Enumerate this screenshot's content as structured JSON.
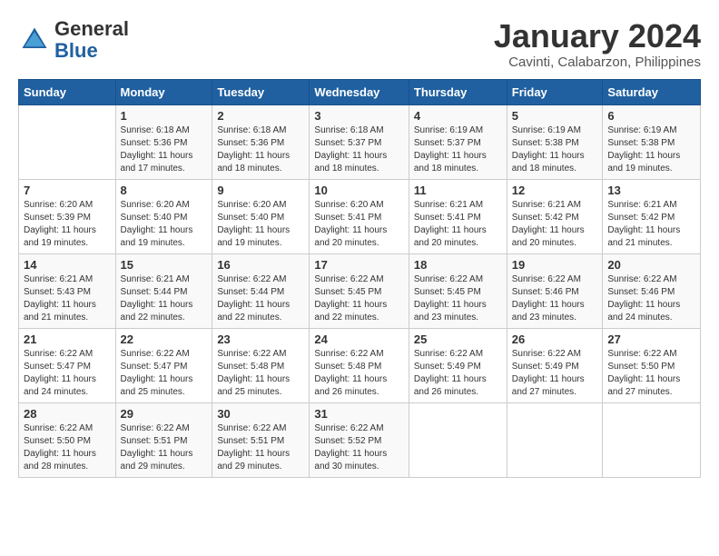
{
  "header": {
    "logo_general": "General",
    "logo_blue": "Blue",
    "month_title": "January 2024",
    "location": "Cavinti, Calabarzon, Philippines"
  },
  "days_of_week": [
    "Sunday",
    "Monday",
    "Tuesday",
    "Wednesday",
    "Thursday",
    "Friday",
    "Saturday"
  ],
  "weeks": [
    [
      {
        "day": "",
        "sunrise": "",
        "sunset": "",
        "daylight": ""
      },
      {
        "day": "1",
        "sunrise": "6:18 AM",
        "sunset": "5:36 PM",
        "daylight": "11 hours and 17 minutes."
      },
      {
        "day": "2",
        "sunrise": "6:18 AM",
        "sunset": "5:36 PM",
        "daylight": "11 hours and 18 minutes."
      },
      {
        "day": "3",
        "sunrise": "6:18 AM",
        "sunset": "5:37 PM",
        "daylight": "11 hours and 18 minutes."
      },
      {
        "day": "4",
        "sunrise": "6:19 AM",
        "sunset": "5:37 PM",
        "daylight": "11 hours and 18 minutes."
      },
      {
        "day": "5",
        "sunrise": "6:19 AM",
        "sunset": "5:38 PM",
        "daylight": "11 hours and 18 minutes."
      },
      {
        "day": "6",
        "sunrise": "6:19 AM",
        "sunset": "5:38 PM",
        "daylight": "11 hours and 19 minutes."
      }
    ],
    [
      {
        "day": "7",
        "sunrise": "6:20 AM",
        "sunset": "5:39 PM",
        "daylight": "11 hours and 19 minutes."
      },
      {
        "day": "8",
        "sunrise": "6:20 AM",
        "sunset": "5:40 PM",
        "daylight": "11 hours and 19 minutes."
      },
      {
        "day": "9",
        "sunrise": "6:20 AM",
        "sunset": "5:40 PM",
        "daylight": "11 hours and 19 minutes."
      },
      {
        "day": "10",
        "sunrise": "6:20 AM",
        "sunset": "5:41 PM",
        "daylight": "11 hours and 20 minutes."
      },
      {
        "day": "11",
        "sunrise": "6:21 AM",
        "sunset": "5:41 PM",
        "daylight": "11 hours and 20 minutes."
      },
      {
        "day": "12",
        "sunrise": "6:21 AM",
        "sunset": "5:42 PM",
        "daylight": "11 hours and 20 minutes."
      },
      {
        "day": "13",
        "sunrise": "6:21 AM",
        "sunset": "5:42 PM",
        "daylight": "11 hours and 21 minutes."
      }
    ],
    [
      {
        "day": "14",
        "sunrise": "6:21 AM",
        "sunset": "5:43 PM",
        "daylight": "11 hours and 21 minutes."
      },
      {
        "day": "15",
        "sunrise": "6:21 AM",
        "sunset": "5:44 PM",
        "daylight": "11 hours and 22 minutes."
      },
      {
        "day": "16",
        "sunrise": "6:22 AM",
        "sunset": "5:44 PM",
        "daylight": "11 hours and 22 minutes."
      },
      {
        "day": "17",
        "sunrise": "6:22 AM",
        "sunset": "5:45 PM",
        "daylight": "11 hours and 22 minutes."
      },
      {
        "day": "18",
        "sunrise": "6:22 AM",
        "sunset": "5:45 PM",
        "daylight": "11 hours and 23 minutes."
      },
      {
        "day": "19",
        "sunrise": "6:22 AM",
        "sunset": "5:46 PM",
        "daylight": "11 hours and 23 minutes."
      },
      {
        "day": "20",
        "sunrise": "6:22 AM",
        "sunset": "5:46 PM",
        "daylight": "11 hours and 24 minutes."
      }
    ],
    [
      {
        "day": "21",
        "sunrise": "6:22 AM",
        "sunset": "5:47 PM",
        "daylight": "11 hours and 24 minutes."
      },
      {
        "day": "22",
        "sunrise": "6:22 AM",
        "sunset": "5:47 PM",
        "daylight": "11 hours and 25 minutes."
      },
      {
        "day": "23",
        "sunrise": "6:22 AM",
        "sunset": "5:48 PM",
        "daylight": "11 hours and 25 minutes."
      },
      {
        "day": "24",
        "sunrise": "6:22 AM",
        "sunset": "5:48 PM",
        "daylight": "11 hours and 26 minutes."
      },
      {
        "day": "25",
        "sunrise": "6:22 AM",
        "sunset": "5:49 PM",
        "daylight": "11 hours and 26 minutes."
      },
      {
        "day": "26",
        "sunrise": "6:22 AM",
        "sunset": "5:49 PM",
        "daylight": "11 hours and 27 minutes."
      },
      {
        "day": "27",
        "sunrise": "6:22 AM",
        "sunset": "5:50 PM",
        "daylight": "11 hours and 27 minutes."
      }
    ],
    [
      {
        "day": "28",
        "sunrise": "6:22 AM",
        "sunset": "5:50 PM",
        "daylight": "11 hours and 28 minutes."
      },
      {
        "day": "29",
        "sunrise": "6:22 AM",
        "sunset": "5:51 PM",
        "daylight": "11 hours and 29 minutes."
      },
      {
        "day": "30",
        "sunrise": "6:22 AM",
        "sunset": "5:51 PM",
        "daylight": "11 hours and 29 minutes."
      },
      {
        "day": "31",
        "sunrise": "6:22 AM",
        "sunset": "5:52 PM",
        "daylight": "11 hours and 30 minutes."
      },
      {
        "day": "",
        "sunrise": "",
        "sunset": "",
        "daylight": ""
      },
      {
        "day": "",
        "sunrise": "",
        "sunset": "",
        "daylight": ""
      },
      {
        "day": "",
        "sunrise": "",
        "sunset": "",
        "daylight": ""
      }
    ]
  ]
}
